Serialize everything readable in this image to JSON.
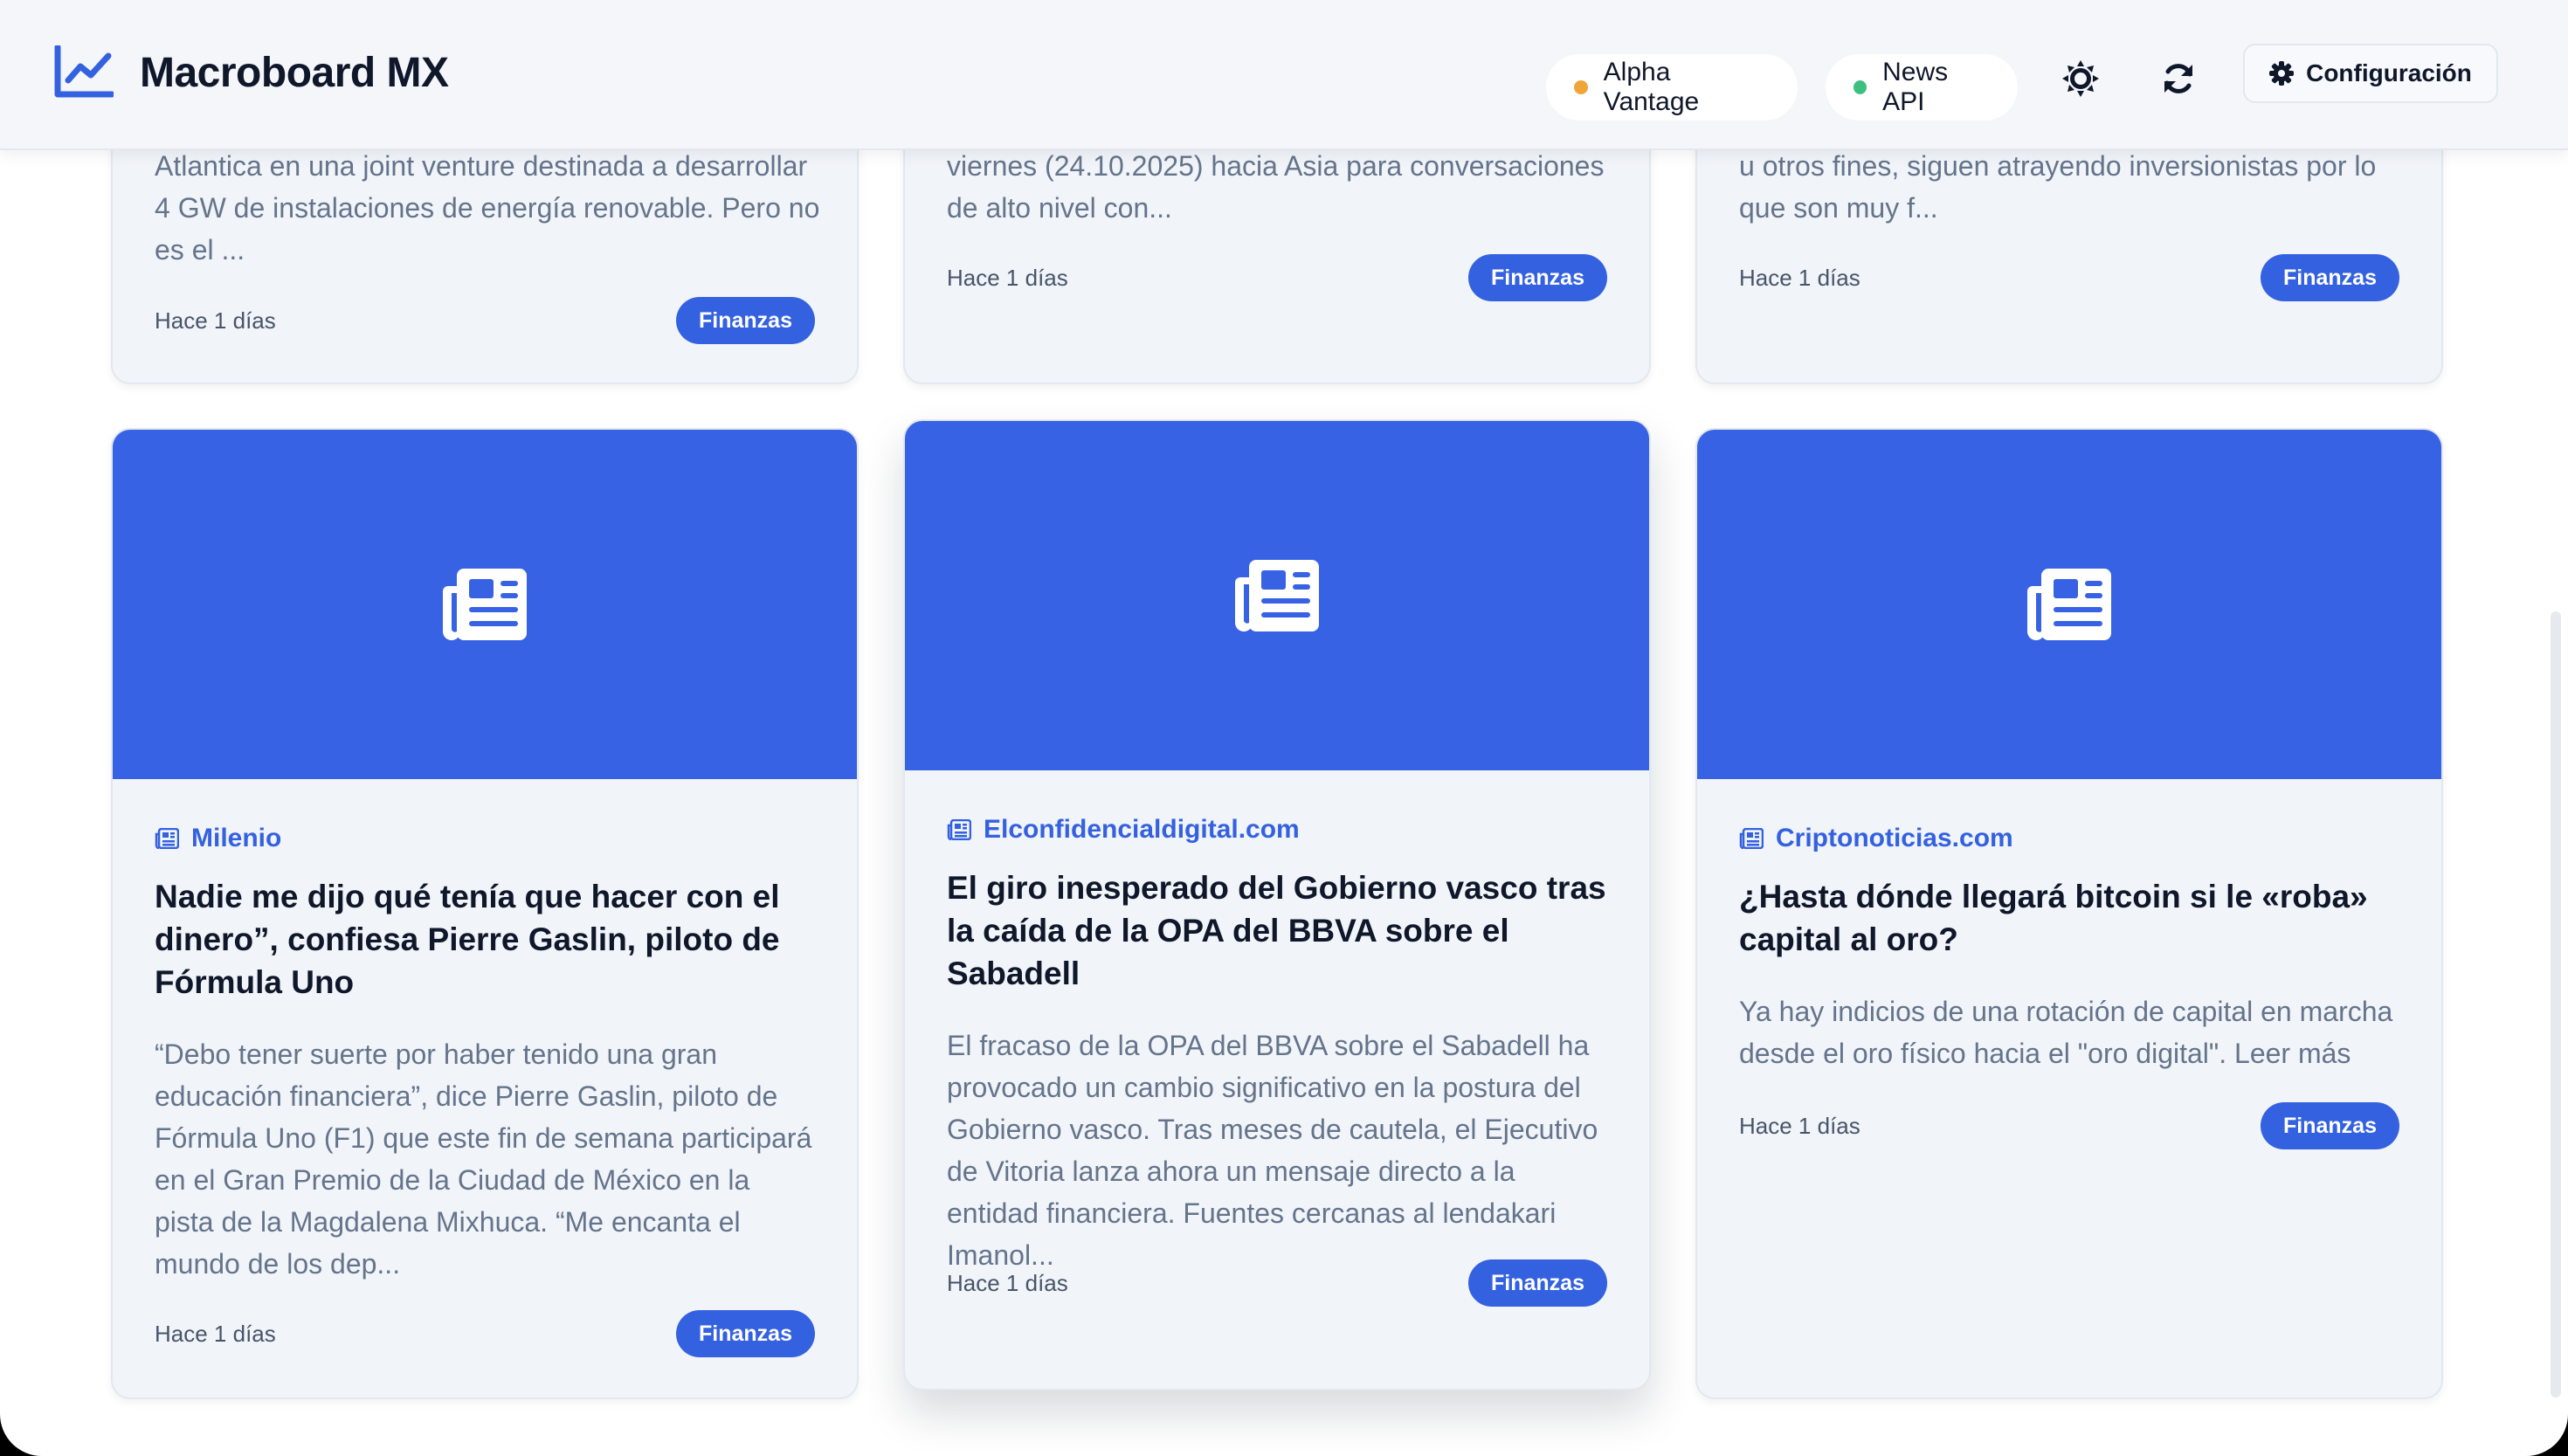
{
  "app": {
    "title": "Macroboard MX"
  },
  "header": {
    "status": [
      {
        "label": "Alpha Vantage",
        "color": "#f0a53a"
      },
      {
        "label": "News API",
        "color": "#3fbf7f"
      }
    ],
    "theme_icon": "sun-icon",
    "refresh_icon": "refresh-icon",
    "config_label": "Configuración"
  },
  "colors": {
    "accent": "#3461e0",
    "image_bg": "#3862e4"
  },
  "top_cards": [
    {
      "excerpt": "Atlantica en una joint venture destinada a desarrollar 4 GW de instalaciones de energía renovable. Pero no es el ...",
      "time": "Hace 1 días",
      "tag": "Finanzas"
    },
    {
      "excerpt": "viernes (24.10.2025) hacia Asia para conversaciones de alto nivel con...",
      "time": "Hace 1 días",
      "tag": "Finanzas"
    },
    {
      "excerpt": "u otros fines, siguen atrayendo inversionistas por lo que son muy f...",
      "time": "Hace 1 días",
      "tag": "Finanzas"
    }
  ],
  "cards": [
    {
      "source": "Milenio",
      "headline": "Nadie me dijo qué tenía que hacer con el dinero”, confiesa Pierre Gaslin, piloto de Fórmula Uno",
      "excerpt": "“Debo tener suerte por haber tenido una gran educación financiera”, dice Pierre Gaslin, piloto de Fórmula Uno (F1) que este fin de semana participará en el Gran Premio de la Ciudad de México en la pista de la Magdalena Mixhuca. “Me encanta el mundo de los dep...",
      "time": "Hace 1 días",
      "tag": "Finanzas"
    },
    {
      "source": "Elconfidencialdigital.com",
      "headline": "El giro inesperado del Gobierno vasco tras la caída de la OPA del BBVA sobre el Sabadell",
      "excerpt": "El fracaso de la OPA del BBVA sobre el Sabadell ha provocado un cambio significativo en la postura del Gobierno vasco. Tras meses de cautela, el Ejecutivo de Vitoria lanza ahora un mensaje directo a la entidad financiera. Fuentes cercanas al lendakari Imanol...",
      "time": "Hace 1 días",
      "tag": "Finanzas"
    },
    {
      "source": "Criptonoticias.com",
      "headline": "¿Hasta dónde llegará bitcoin si le «roba» capital al oro?",
      "excerpt": "Ya hay indicios de una rotación de capital en marcha desde el oro físico hacia el \"oro digital\". Leer más",
      "time": "Hace 1 días",
      "tag": "Finanzas"
    }
  ]
}
